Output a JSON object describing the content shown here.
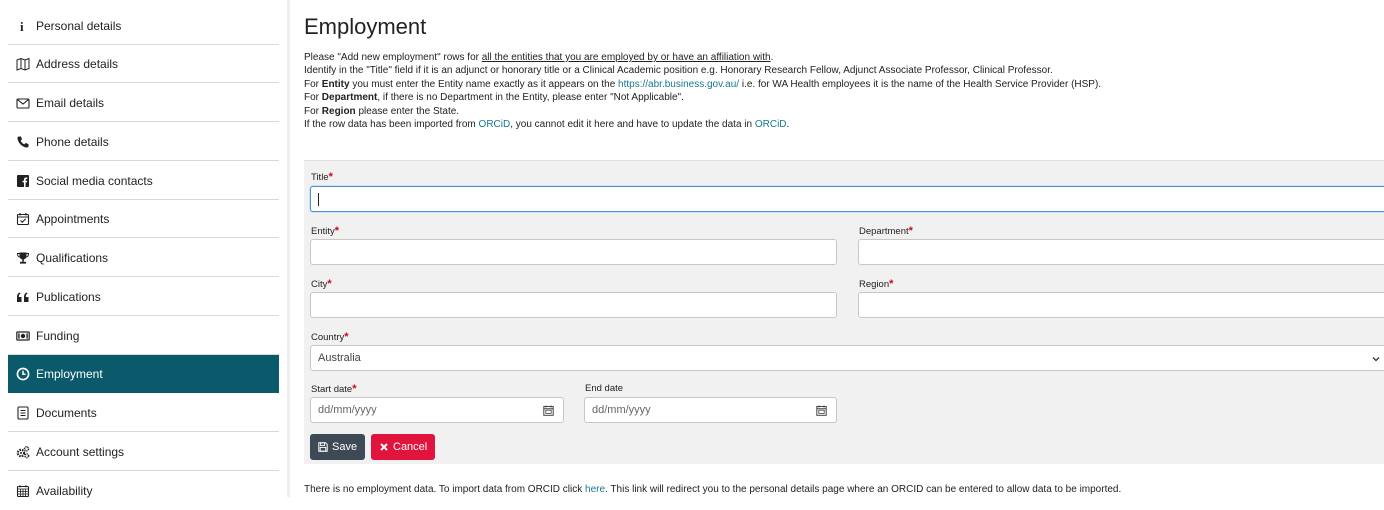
{
  "sidebar": {
    "items": [
      {
        "label": "Personal details",
        "icon": "info-icon"
      },
      {
        "label": "Address details",
        "icon": "map-icon"
      },
      {
        "label": "Email details",
        "icon": "envelope-icon"
      },
      {
        "label": "Phone details",
        "icon": "phone-icon"
      },
      {
        "label": "Social media contacts",
        "icon": "facebook-icon"
      },
      {
        "label": "Appointments",
        "icon": "calendar-check-icon"
      },
      {
        "label": "Qualifications",
        "icon": "trophy-icon"
      },
      {
        "label": "Publications",
        "icon": "quote-icon"
      },
      {
        "label": "Funding",
        "icon": "money-icon"
      },
      {
        "label": "Employment",
        "icon": "clock-icon",
        "active": true
      },
      {
        "label": "Documents",
        "icon": "document-icon"
      },
      {
        "label": "Account settings",
        "icon": "gears-icon"
      },
      {
        "label": "Availability",
        "icon": "calendar-icon"
      }
    ],
    "active_color": "#0b5a6b"
  },
  "main": {
    "title": "Employment",
    "intro": {
      "line1_pre": "Please \"Add new employment\" rows for ",
      "line1_link": "all the entities that you are employed by or have an affiliation with",
      "line1_post": ".",
      "line2": "Identify in the \"Title\" field if it is an adjunct or honorary title or a Clinical Academic position e.g. Honorary Research Fellow, Adjunct Associate Professor, Clinical Professor.",
      "line3_pre": "For ",
      "line3_bold": "Entity",
      "line3_mid": " you must enter the Entity name exactly as it appears on the ",
      "line3_link": "https://abr.business.gov.au/",
      "line3_post": " i.e. for WA Health employees it is the name of the Health Service Provider (HSP).",
      "line4_pre": "For ",
      "line4_bold": "Department",
      "line4_post": ", if there is no Department in the Entity, please enter \"Not Applicable\".",
      "line5_pre": "For ",
      "line5_bold": "Region",
      "line5_post": " please enter the State.",
      "line6_pre": "If the row data has been imported from ",
      "line6_link1": "ORCiD",
      "line6_mid": ", you cannot edit it here and have to update the data in ",
      "line6_link2": "ORCiD",
      "line6_post": "."
    },
    "form": {
      "required_mark": "*",
      "title_label": "Title",
      "entity_label": "Entity",
      "department_label": "Department",
      "city_label": "City",
      "region_label": "Region",
      "country_label": "Country",
      "country_value": "Australia",
      "start_date_label": "Start date",
      "start_date_placeholder": "dd/mm/yyyy",
      "end_date_label": "End date",
      "end_date_placeholder": "dd/mm/yyyy",
      "save_label": "Save",
      "cancel_label": "Cancel"
    },
    "footer": {
      "pre": "There is no employment data. To import data from ORCID click ",
      "link": "here",
      "post": ". This link will redirect you to the personal details page where an ORCID can be entered to allow data to be imported."
    }
  },
  "colors": {
    "link": "#17788e",
    "required": "#d0021b",
    "save_button": "#3d4a55",
    "cancel_button": "#e0143d"
  }
}
